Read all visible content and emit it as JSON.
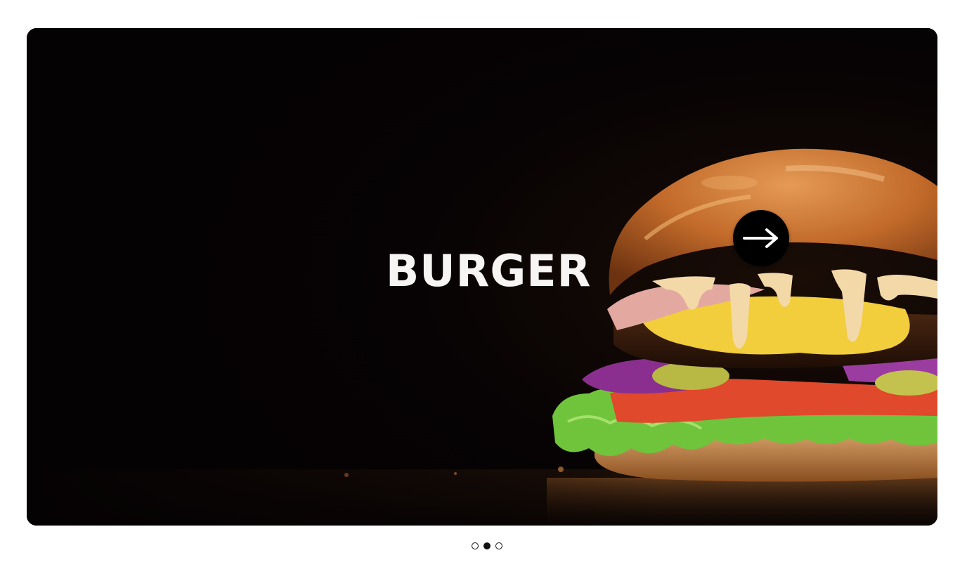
{
  "slider": {
    "slide_title": "BURGER",
    "next_icon": "arrow-right-icon",
    "image_subject": "burger",
    "colors": {
      "background": "#050203",
      "title": "#f7f4f4",
      "button": "#000000"
    },
    "dots": {
      "count": 3,
      "active_index": 1
    }
  }
}
